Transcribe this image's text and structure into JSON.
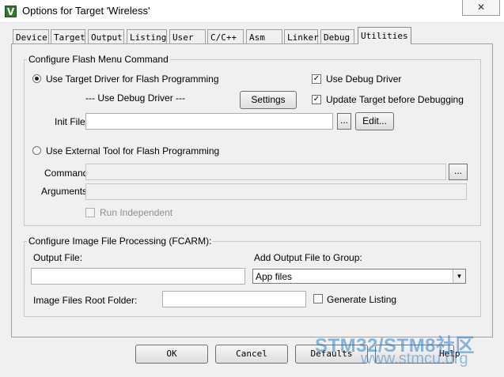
{
  "window": {
    "title": "Options for Target 'Wireless'",
    "close_label": "✕"
  },
  "tabs": [
    "Device",
    "Target",
    "Output",
    "Listing",
    "User",
    "C/C++",
    "Asm",
    "Linker",
    "Debug",
    "Utilities"
  ],
  "active_tab": "Utilities",
  "flash_menu": {
    "legend": "Configure Flash Menu Command",
    "use_target_driver": "Use Target Driver for Flash Programming",
    "driver_value": "--- Use Debug Driver ---",
    "settings_button": "Settings",
    "use_debug_driver": "Use Debug Driver",
    "use_debug_driver_checked": true,
    "update_target": "Update Target before Debugging",
    "update_target_checked": true,
    "init_file_label": "Init File:",
    "init_file_value": "",
    "browse_button": "...",
    "edit_button": "Edit...",
    "use_external_tool": "Use External Tool for Flash Programming",
    "command_label": "Command:",
    "command_value": "",
    "command_browse": "...",
    "arguments_label": "Arguments:",
    "arguments_value": "",
    "run_independent": "Run Independent",
    "run_independent_checked": false
  },
  "image_processing": {
    "legend": "Configure Image File Processing (FCARM):",
    "output_file_label": "Output File:",
    "output_file_value": "",
    "add_output_label": "Add Output File  to Group:",
    "group_value": "App files",
    "root_folder_label": "Image Files Root Folder:",
    "root_folder_value": "",
    "generate_listing": "Generate Listing",
    "generate_listing_checked": false
  },
  "buttons": {
    "ok": "OK",
    "cancel": "Cancel",
    "defaults": "Defaults",
    "help": "Help"
  },
  "watermark": {
    "line1": "STM32/STM8社区",
    "line2": "www.stmcu.org"
  }
}
